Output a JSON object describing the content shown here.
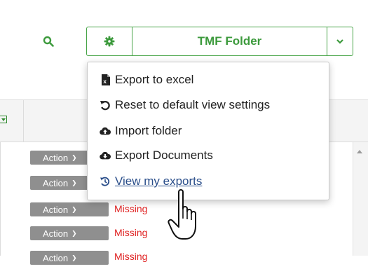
{
  "toolbar": {
    "search_icon": "search-icon",
    "folder_button_label": "TMF Folder",
    "settings_icon": "gear-icon",
    "dropdown_icon": "chevron-down-icon",
    "accent_color": "#47a447"
  },
  "menu": {
    "items": [
      {
        "label": "Export to excel",
        "icon": "excel-file-icon"
      },
      {
        "label": "Reset to default view settings",
        "icon": "undo-icon"
      },
      {
        "label": "Import folder",
        "icon": "cloud-upload-icon"
      },
      {
        "label": "Export Documents",
        "icon": "cloud-download-icon"
      },
      {
        "label": "View my exports",
        "icon": "history-icon"
      }
    ]
  },
  "table": {
    "rows": [
      {
        "action_label": "Action",
        "status": ""
      },
      {
        "action_label": "Action",
        "status": ""
      },
      {
        "action_label": "Action",
        "status": "Missing"
      },
      {
        "action_label": "Action",
        "status": "Missing"
      },
      {
        "action_label": "Action",
        "status": "Missing"
      }
    ],
    "status_color": "#e02424"
  }
}
